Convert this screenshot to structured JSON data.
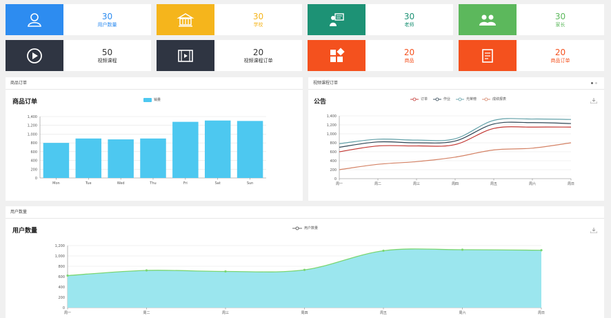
{
  "cards_row1": [
    {
      "value": "30",
      "label": "用户数量",
      "bg": "#2d8cf0",
      "fg": "#2d8cf0",
      "icon": "user-icon"
    },
    {
      "value": "30",
      "label": "学校",
      "bg": "#f5b51c",
      "fg": "#f5b51c",
      "icon": "school-icon"
    },
    {
      "value": "30",
      "label": "老师",
      "bg": "#1d9275",
      "fg": "#1d9275",
      "icon": "teacher-icon"
    },
    {
      "value": "30",
      "label": "家长",
      "bg": "#5cb85c",
      "fg": "#5cb85c",
      "icon": "parents-icon"
    }
  ],
  "cards_row2": [
    {
      "value": "50",
      "label": "视频课程",
      "bg": "#2f3542",
      "fg": "#333333",
      "icon": "play-icon"
    },
    {
      "value": "20",
      "label": "视频课程订单",
      "bg": "#2f3542",
      "fg": "#333333",
      "icon": "film-icon"
    },
    {
      "value": "20",
      "label": "商品",
      "bg": "#f4511e",
      "fg": "#f4511e",
      "icon": "grid-icon"
    },
    {
      "value": "20",
      "label": "商品订单",
      "bg": "#f4511e",
      "fg": "#f4511e",
      "icon": "document-icon"
    }
  ],
  "panel_goods": {
    "header": "商品订单",
    "title": "商品订单"
  },
  "panel_video": {
    "header": "视频课程订单",
    "title": "公告"
  },
  "panel_users": {
    "header": "用户数量",
    "title": "用户数量"
  },
  "colors": {
    "bar": "#4dc8f0",
    "area_fill": "#9be6ee",
    "area_line": "#7bd672"
  },
  "chart_data": [
    {
      "type": "bar",
      "categories": [
        "Mon",
        "Tue",
        "Wed",
        "Thu",
        "Fri",
        "Sat",
        "Sun"
      ],
      "series": [
        {
          "name": "销量",
          "values": [
            800,
            900,
            880,
            900,
            1280,
            1310,
            1300
          ]
        }
      ],
      "yticks": [
        "0",
        "200",
        "400",
        "600",
        "800",
        "1,000",
        "1,200",
        "1,400"
      ],
      "ylim": [
        0,
        1400
      ],
      "grid": true,
      "legend": "top-center"
    },
    {
      "type": "line",
      "categories": [
        "周一",
        "周二",
        "周三",
        "周四",
        "周五",
        "周六",
        "周日"
      ],
      "series": [
        {
          "name": "订单",
          "color": "#c23531",
          "values": [
            600,
            730,
            730,
            760,
            1120,
            1150,
            1150
          ]
        },
        {
          "name": "作业",
          "color": "#2f4554",
          "values": [
            700,
            820,
            800,
            840,
            1220,
            1250,
            1230
          ]
        },
        {
          "name": "光荣榜",
          "color": "#61a0a8",
          "values": [
            780,
            880,
            860,
            890,
            1300,
            1330,
            1320
          ]
        },
        {
          "name": "成绩报表",
          "color": "#d48265",
          "values": [
            200,
            320,
            380,
            480,
            640,
            680,
            800
          ]
        }
      ],
      "yticks": [
        "0",
        "200",
        "400",
        "600",
        "800",
        "1,000",
        "1,200",
        "1,400"
      ],
      "ylim": [
        0,
        1400
      ],
      "grid": true,
      "legend": "top-center"
    },
    {
      "type": "area",
      "categories": [
        "周一",
        "周二",
        "周三",
        "周四",
        "周五",
        "周六",
        "周日"
      ],
      "series": [
        {
          "name": "用户数量",
          "values": [
            620,
            720,
            700,
            730,
            1100,
            1120,
            1110
          ]
        }
      ],
      "yticks": [
        "0",
        "200",
        "400",
        "600",
        "800",
        "1,000",
        "1,200"
      ],
      "ylim": [
        0,
        1200
      ],
      "grid": true,
      "legend": "top-center"
    }
  ]
}
